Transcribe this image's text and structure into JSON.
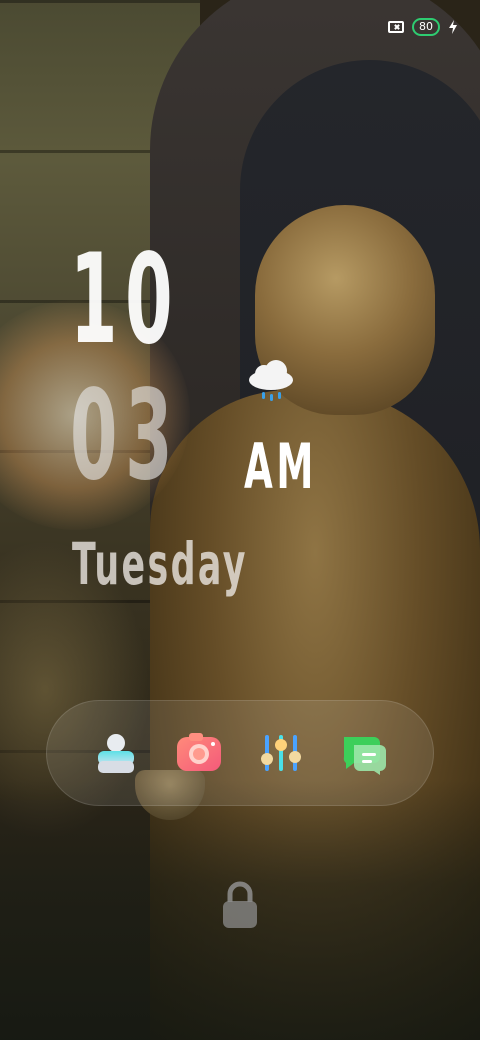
{
  "status_bar": {
    "sim_icon": "no-sim-icon",
    "battery_level": "80",
    "battery_color": "#2ecc71",
    "charging_icon": "bolt-icon"
  },
  "lockscreen": {
    "hour": "10",
    "minute": "03",
    "ampm": "AM",
    "day": "Tuesday",
    "weather_icon": "rain-cloud-icon"
  },
  "dock": {
    "apps": [
      {
        "name": "contacts",
        "icon": "contacts-icon"
      },
      {
        "name": "camera",
        "icon": "camera-icon"
      },
      {
        "name": "settings",
        "icon": "sliders-icon"
      },
      {
        "name": "messages",
        "icon": "messages-icon"
      }
    ]
  },
  "lock": {
    "icon": "padlock-icon"
  }
}
